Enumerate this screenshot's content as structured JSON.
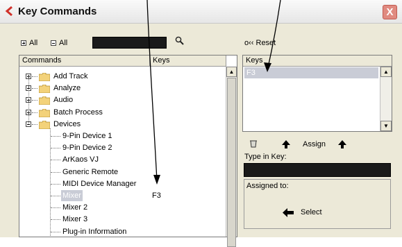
{
  "window": {
    "title": "Key Commands",
    "close_glyph": "X"
  },
  "toolbar": {
    "expand_all_label": "All",
    "collapse_all_label": "All",
    "search_value": "",
    "reset_label": "o‹‹ Reset"
  },
  "commands_panel": {
    "col_commands": "Commands",
    "col_keys": "Keys",
    "items": [
      {
        "label": "Add Track",
        "type": "folder",
        "expanded": false,
        "key": ""
      },
      {
        "label": "Analyze",
        "type": "folder",
        "expanded": false,
        "key": ""
      },
      {
        "label": "Audio",
        "type": "folder",
        "expanded": false,
        "key": ""
      },
      {
        "label": "Batch Process",
        "type": "folder",
        "expanded": false,
        "key": ""
      },
      {
        "label": "Devices",
        "type": "folder",
        "expanded": true,
        "key": ""
      },
      {
        "label": "9-Pin Device 1",
        "type": "leaf",
        "key": ""
      },
      {
        "label": "9-Pin Device 2",
        "type": "leaf",
        "key": ""
      },
      {
        "label": "ArKaos VJ",
        "type": "leaf",
        "key": ""
      },
      {
        "label": "Generic Remote",
        "type": "leaf",
        "key": ""
      },
      {
        "label": "MIDI Device Manager",
        "type": "leaf",
        "key": ""
      },
      {
        "label": "Mixer",
        "type": "leaf",
        "key": "F3",
        "selected": true
      },
      {
        "label": "Mixer 2",
        "type": "leaf",
        "key": ""
      },
      {
        "label": "Mixer 3",
        "type": "leaf",
        "key": ""
      },
      {
        "label": "Plug-in Information",
        "type": "leaf",
        "key": ""
      }
    ]
  },
  "keys_panel": {
    "header": "Keys",
    "items": [
      "F3"
    ]
  },
  "assign_row": {
    "assign_label": "Assign"
  },
  "type_in_key": {
    "label": "Type in Key:",
    "value": ""
  },
  "assigned_to": {
    "label": "Assigned to:",
    "select_label": "Select"
  },
  "colors": {
    "selection_bg": "#c9ccd6",
    "selection_text": "#ffffff",
    "folder": "#f3d27a",
    "dark_field": "#1a1a1a",
    "close_btn": "#e08a80"
  }
}
